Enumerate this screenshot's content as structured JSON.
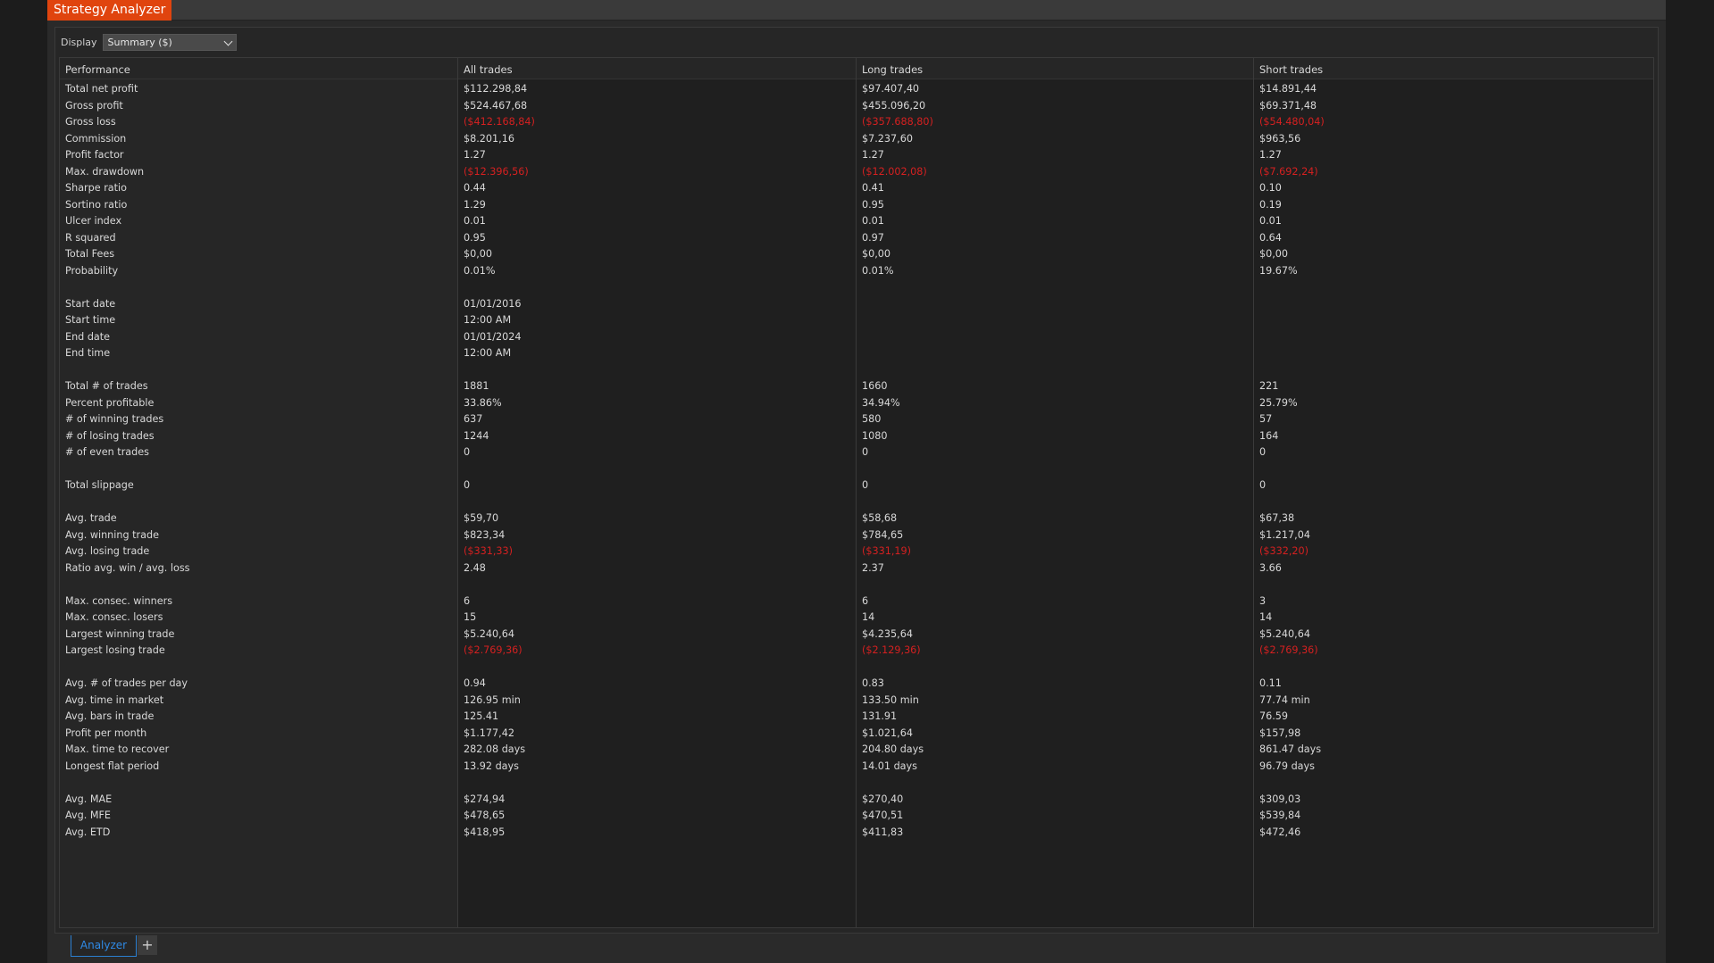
{
  "window": {
    "title": "Strategy Analyzer"
  },
  "display": {
    "label": "Display",
    "selected": "Summary ($)"
  },
  "columns": [
    "Performance",
    "All trades",
    "Long trades",
    "Short trades"
  ],
  "rows": [
    {
      "label": "Total net profit",
      "all": "$112.298,84",
      "long": "$97.407,40",
      "short": "$14.891,44"
    },
    {
      "label": "Gross profit",
      "all": "$524.467,68",
      "long": "$455.096,20",
      "short": "$69.371,48"
    },
    {
      "label": "Gross loss",
      "all": "($412.168,84)",
      "long": "($357.688,80)",
      "short": "($54.480,04)",
      "negative": true
    },
    {
      "label": "Commission",
      "all": "$8.201,16",
      "long": "$7.237,60",
      "short": "$963,56"
    },
    {
      "label": "Profit factor",
      "all": "1.27",
      "long": "1.27",
      "short": "1.27"
    },
    {
      "label": "Max. drawdown",
      "all": "($12.396,56)",
      "long": "($12.002,08)",
      "short": "($7.692,24)",
      "negative": true
    },
    {
      "label": "Sharpe ratio",
      "all": "0.44",
      "long": "0.41",
      "short": "0.10"
    },
    {
      "label": "Sortino ratio",
      "all": "1.29",
      "long": "0.95",
      "short": "0.19"
    },
    {
      "label": "Ulcer index",
      "all": "0.01",
      "long": "0.01",
      "short": "0.01"
    },
    {
      "label": "R squared",
      "all": "0.95",
      "long": "0.97",
      "short": "0.64"
    },
    {
      "label": "Total Fees",
      "all": "$0,00",
      "long": "$0,00",
      "short": "$0,00"
    },
    {
      "label": "Probability",
      "all": "0.01%",
      "long": "0.01%",
      "short": "19.67%"
    },
    {
      "label": "",
      "all": "",
      "long": "",
      "short": ""
    },
    {
      "label": "Start date",
      "all": "01/01/2016",
      "long": "",
      "short": ""
    },
    {
      "label": "Start time",
      "all": "12:00 AM",
      "long": "",
      "short": ""
    },
    {
      "label": "End date",
      "all": "01/01/2024",
      "long": "",
      "short": ""
    },
    {
      "label": "End time",
      "all": "12:00 AM",
      "long": "",
      "short": ""
    },
    {
      "label": "",
      "all": "",
      "long": "",
      "short": ""
    },
    {
      "label": "Total # of trades",
      "all": "1881",
      "long": "1660",
      "short": "221"
    },
    {
      "label": "Percent profitable",
      "all": "33.86%",
      "long": "34.94%",
      "short": "25.79%"
    },
    {
      "label": "# of winning trades",
      "all": "637",
      "long": "580",
      "short": "57"
    },
    {
      "label": "# of losing trades",
      "all": "1244",
      "long": "1080",
      "short": "164"
    },
    {
      "label": "# of even trades",
      "all": "0",
      "long": "0",
      "short": "0"
    },
    {
      "label": "",
      "all": "",
      "long": "",
      "short": ""
    },
    {
      "label": "Total slippage",
      "all": "0",
      "long": "0",
      "short": "0"
    },
    {
      "label": "",
      "all": "",
      "long": "",
      "short": ""
    },
    {
      "label": "Avg. trade",
      "all": "$59,70",
      "long": "$58,68",
      "short": "$67,38"
    },
    {
      "label": "Avg. winning trade",
      "all": "$823,34",
      "long": "$784,65",
      "short": "$1.217,04"
    },
    {
      "label": "Avg. losing trade",
      "all": "($331,33)",
      "long": "($331,19)",
      "short": "($332,20)",
      "negative": true
    },
    {
      "label": "Ratio avg. win / avg. loss",
      "all": "2.48",
      "long": "2.37",
      "short": "3.66"
    },
    {
      "label": "",
      "all": "",
      "long": "",
      "short": ""
    },
    {
      "label": "Max. consec. winners",
      "all": "6",
      "long": "6",
      "short": "3"
    },
    {
      "label": "Max. consec. losers",
      "all": "15",
      "long": "14",
      "short": "14"
    },
    {
      "label": "Largest winning trade",
      "all": "$5.240,64",
      "long": "$4.235,64",
      "short": "$5.240,64"
    },
    {
      "label": "Largest losing trade",
      "all": "($2.769,36)",
      "long": "($2.129,36)",
      "short": "($2.769,36)",
      "negative": true
    },
    {
      "label": "",
      "all": "",
      "long": "",
      "short": ""
    },
    {
      "label": "Avg. # of trades per day",
      "all": "0.94",
      "long": "0.83",
      "short": "0.11"
    },
    {
      "label": "Avg. time in market",
      "all": "126.95 min",
      "long": "133.50 min",
      "short": "77.74 min"
    },
    {
      "label": "Avg. bars in trade",
      "all": "125.41",
      "long": "131.91",
      "short": "76.59"
    },
    {
      "label": "Profit per month",
      "all": "$1.177,42",
      "long": "$1.021,64",
      "short": "$157,98"
    },
    {
      "label": "Max. time to recover",
      "all": "282.08 days",
      "long": "204.80 days",
      "short": "861.47 days"
    },
    {
      "label": "Longest flat period",
      "all": "13.92 days",
      "long": "14.01 days",
      "short": "96.79 days"
    },
    {
      "label": "",
      "all": "",
      "long": "",
      "short": ""
    },
    {
      "label": "Avg. MAE",
      "all": "$274,94",
      "long": "$270,40",
      "short": "$309,03"
    },
    {
      "label": "Avg. MFE",
      "all": "$478,65",
      "long": "$470,51",
      "short": "$539,84"
    },
    {
      "label": "Avg. ETD",
      "all": "$418,95",
      "long": "$411,83",
      "short": "$472,46"
    }
  ],
  "bottom_tabs": {
    "analyzer": "Analyzer",
    "add": "+"
  },
  "colors": {
    "accent": "#e0440e",
    "negative": "#d42020",
    "tab_active": "#2f8ae6"
  }
}
